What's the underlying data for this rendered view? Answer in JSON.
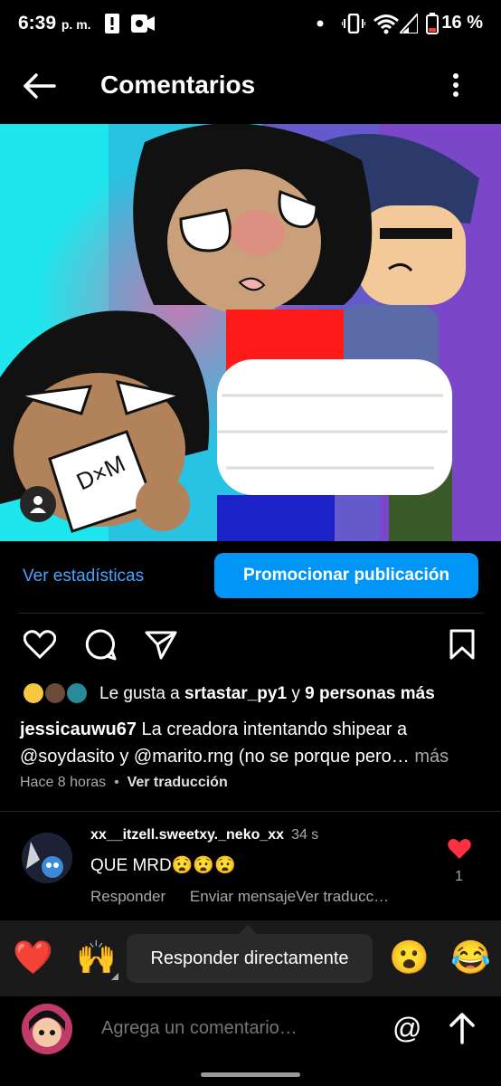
{
  "status_bar": {
    "time": "6:39",
    "ampm": "p. m.",
    "battery": "16 %",
    "battery_color": "#ff3b30"
  },
  "header": {
    "back_icon": "back-arrow-icon",
    "title": "Comentarios",
    "menu_icon": "more-vertical-icon"
  },
  "post": {
    "image_description_icon": "user-tag-icon",
    "stats_link": "Ver estadísticas",
    "promote_button": "Promocionar publicación",
    "likes_prefix": "Le gusta a ",
    "likes_user": "srtastar_py1",
    "likes_middle": " y ",
    "likes_others": "9 personas más",
    "caption_user": "jessicauwu67",
    "caption_text": " La creadora intentando shipear a @soydasito y @marito.rng (no se porque pero…",
    "caption_more": " más",
    "time_ago": "Hace 8 horas",
    "dot": "•",
    "translate": "Ver traducción"
  },
  "comment": {
    "username": "xx__itzell.sweetxy._neko_xx",
    "time": "34 s",
    "text": "QUE MRD😧😧😧",
    "reply": "Responder",
    "send_message": "Enviar mensaje",
    "translate": "Ver traducc…",
    "likes": "1",
    "heart_color": "#ff3040"
  },
  "reactions": {
    "emojis": [
      "❤️",
      "🙌",
      "😮",
      "😂"
    ],
    "tooltip": "Responder directamente"
  },
  "input": {
    "placeholder": "Agrega un comentario…",
    "at_symbol": "@"
  },
  "colors": {
    "accent": "#0095f6",
    "link": "#4aa3ff"
  }
}
